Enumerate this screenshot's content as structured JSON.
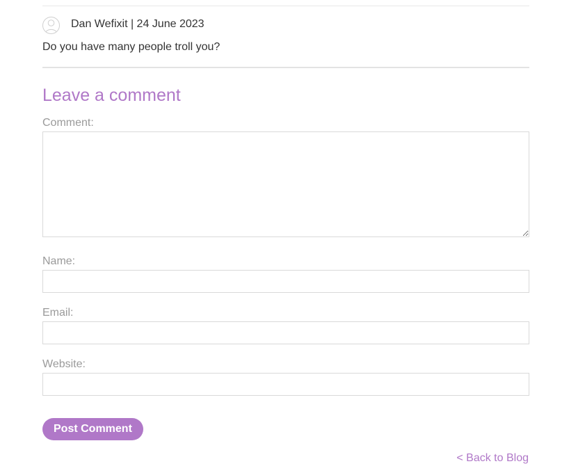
{
  "comment": {
    "author": "Dan Wefixit",
    "separator": "|",
    "date": "24 June 2023",
    "meta_text": "Dan Wefixit | 24 June 2023",
    "body": "Do you have many people troll you?",
    "avatar_icon": "user-avatar-icon"
  },
  "form": {
    "heading": "Leave a comment",
    "comment_label": "Comment:",
    "comment_value": "",
    "name_label": "Name:",
    "name_value": "",
    "email_label": "Email:",
    "email_value": "",
    "website_label": "Website:",
    "website_value": "",
    "submit_label": "Post Comment"
  },
  "nav": {
    "back_label": "< Back to Blog"
  },
  "colors": {
    "accent": "#b078c8",
    "text": "#333333",
    "label": "#9a9a9a",
    "border": "#d9d9d9"
  }
}
